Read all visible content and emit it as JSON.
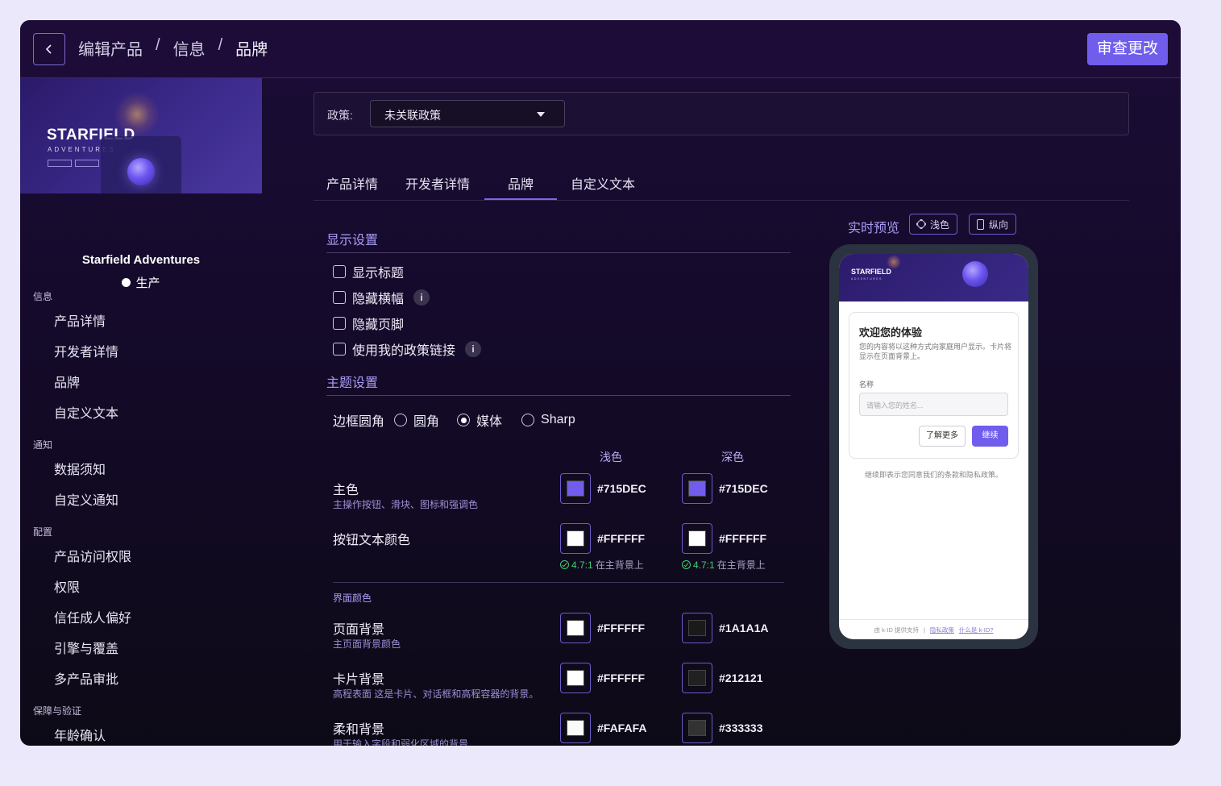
{
  "header": {
    "breadcrumb": [
      "编辑产品",
      "信息",
      "品牌"
    ],
    "separator": "/",
    "review_button": "审查更改"
  },
  "sidebar": {
    "banner": {
      "title": "STARFIELD",
      "subtitle": "ADVENTURES"
    },
    "product_name": "Starfield Adventures",
    "status": "生产",
    "sections": [
      {
        "label": "信息",
        "items": [
          "产品详情",
          "开发者详情",
          "品牌",
          "自定义文本"
        ]
      },
      {
        "label": "通知",
        "items": [
          "数据须知",
          "自定义通知"
        ]
      },
      {
        "label": "配置",
        "items": [
          "产品访问权限",
          "权限",
          "信任成人偏好",
          "引擎与覆盖",
          "多产品审批"
        ]
      },
      {
        "label": "保障与验证",
        "items": [
          "年龄确认"
        ]
      }
    ]
  },
  "policy": {
    "label": "政策:",
    "selected": "未关联政策"
  },
  "tabs": [
    "产品详情",
    "开发者详情",
    "品牌",
    "自定义文本"
  ],
  "active_tab": 2,
  "display_settings": {
    "title": "显示设置",
    "checkboxes": [
      "显示标题",
      "隐藏横幅",
      "隐藏页脚",
      "使用我的政策链接"
    ]
  },
  "theme_settings": {
    "title": "主题设置",
    "border_radius_label": "边框圆角",
    "radius_options": [
      "圆角",
      "媒体",
      "Sharp"
    ],
    "radius_selected": 1,
    "col_light": "浅色",
    "col_dark": "深色",
    "rows": [
      {
        "label": "主色",
        "desc": "主操作按钮、滑块、图标和强调色",
        "light": "#715DEC",
        "dark": "#715DEC"
      },
      {
        "label": "按钮文本颜色",
        "desc": "",
        "light": "#FFFFFF",
        "dark": "#FFFFFF",
        "contrast_ratio": "4.7:1",
        "contrast_note": "在主背景上"
      }
    ],
    "surface_title": "界面颜色",
    "surface_rows": [
      {
        "label": "页面背景",
        "desc": "主页面背景颜色",
        "light": "#FFFFFF",
        "dark": "#1A1A1A"
      },
      {
        "label": "卡片背景",
        "desc": "高程表面 这是卡片、对话框和高程容器的背景。",
        "light": "#FFFFFF",
        "dark": "#212121"
      },
      {
        "label": "柔和背景",
        "desc": "用于输入字段和弱化区域的背景",
        "light": "#FAFAFA",
        "dark": "#333333"
      }
    ]
  },
  "preview": {
    "title": "实时预览",
    "mode_button": "浅色",
    "orientation_button": "纵向",
    "banner_title": "STARFIELD",
    "banner_subtitle": "ADVENTURES",
    "card_title": "欢迎您的体验",
    "card_desc": "您的内容将以这种方式向家庭用户显示。卡片将显示在页面背景上。",
    "field_label": "名称",
    "field_placeholder": "请输入您的姓名...",
    "learn_more": "了解更多",
    "continue": "继续",
    "terms": "继续即表示您同意我们的条款和隐私政策。",
    "footer_powered": "由 k-ID 提供支持",
    "footer_sep": "|",
    "footer_privacy": "隐私政策",
    "footer_what": "什么是 k-ID?"
  }
}
